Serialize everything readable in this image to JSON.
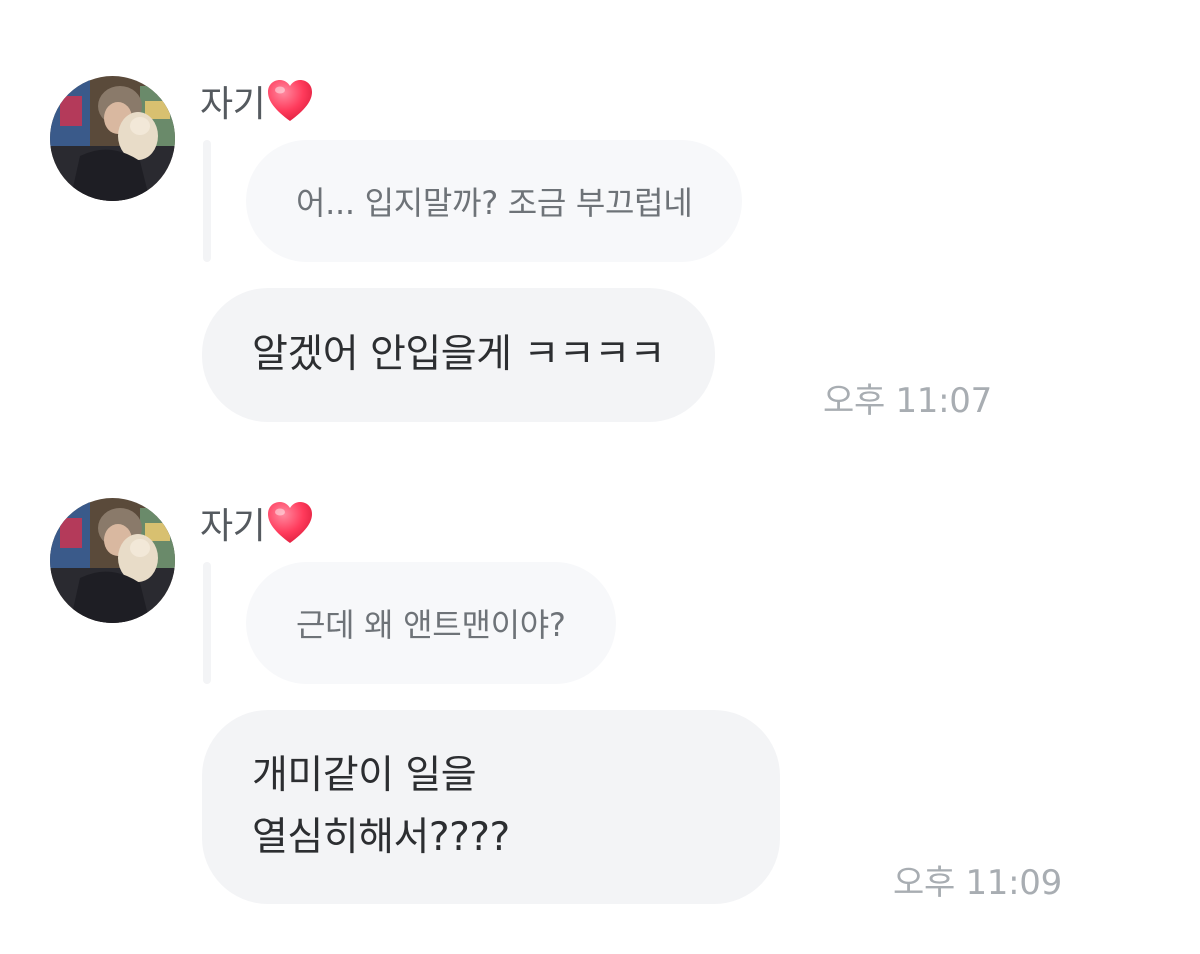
{
  "messages": [
    {
      "sender": "자기",
      "quote": "어... 입지말까? 조금 부끄럽네",
      "text": "알겠어 안입을게 ㅋㅋㅋㅋ",
      "time": "오후 11:07"
    },
    {
      "sender": "자기",
      "quote": "근데 왜 앤트맨이야?",
      "text": "개미같이 일을\n열심히해서????",
      "time": "오후 11:09"
    }
  ],
  "colors": {
    "heart": "#ff3b5c",
    "bubble": "#f3f4f6",
    "quote_bubble": "#f7f8fa",
    "timestamp": "#a8adb2"
  },
  "icons": {
    "avatar": "profile-photo-avatar",
    "heart": "heart-icon"
  }
}
